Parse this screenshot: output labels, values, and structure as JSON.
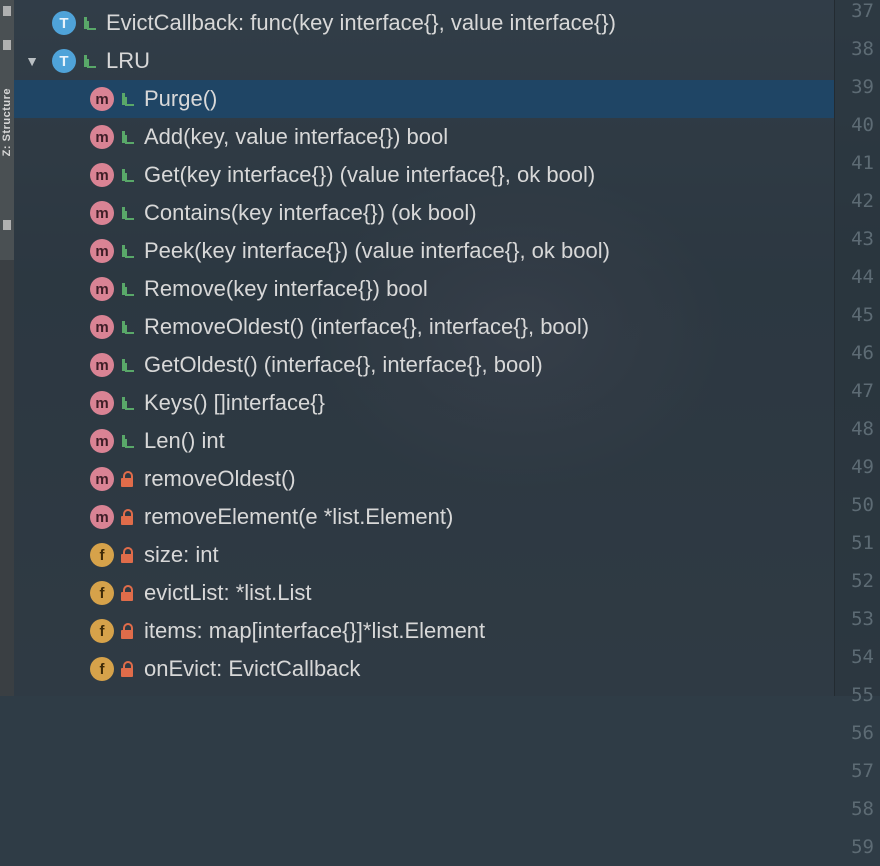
{
  "sidebar_tab": {
    "label": "Z: Structure"
  },
  "tree": [
    {
      "kind": "T",
      "vis": "pub",
      "label": "EvictCallback: func(key interface{}, value interface{})",
      "expanded": false,
      "depth": 0
    },
    {
      "kind": "T",
      "vis": "pub",
      "label": "LRU",
      "expanded": true,
      "depth": 0
    },
    {
      "kind": "m",
      "vis": "pub",
      "label": "Purge()",
      "depth": 1,
      "selected": true
    },
    {
      "kind": "m",
      "vis": "pub",
      "label": "Add(key, value interface{}) bool",
      "depth": 1
    },
    {
      "kind": "m",
      "vis": "pub",
      "label": "Get(key interface{}) (value interface{}, ok bool)",
      "depth": 1
    },
    {
      "kind": "m",
      "vis": "pub",
      "label": "Contains(key interface{}) (ok bool)",
      "depth": 1
    },
    {
      "kind": "m",
      "vis": "pub",
      "label": "Peek(key interface{}) (value interface{}, ok bool)",
      "depth": 1
    },
    {
      "kind": "m",
      "vis": "pub",
      "label": "Remove(key interface{}) bool",
      "depth": 1
    },
    {
      "kind": "m",
      "vis": "pub",
      "label": "RemoveOldest() (interface{}, interface{}, bool)",
      "depth": 1
    },
    {
      "kind": "m",
      "vis": "pub",
      "label": "GetOldest() (interface{}, interface{}, bool)",
      "depth": 1
    },
    {
      "kind": "m",
      "vis": "pub",
      "label": "Keys() []interface{}",
      "depth": 1
    },
    {
      "kind": "m",
      "vis": "pub",
      "label": "Len() int",
      "depth": 1
    },
    {
      "kind": "m",
      "vis": "priv",
      "label": "removeOldest()",
      "depth": 1
    },
    {
      "kind": "m",
      "vis": "priv",
      "label": "removeElement(e *list.Element)",
      "depth": 1
    },
    {
      "kind": "f",
      "vis": "priv",
      "label": "size: int",
      "depth": 1
    },
    {
      "kind": "f",
      "vis": "priv",
      "label": "evictList: *list.List",
      "depth": 1
    },
    {
      "kind": "f",
      "vis": "priv",
      "label": "items: map[interface{}]*list.Element",
      "depth": 1
    },
    {
      "kind": "f",
      "vis": "priv",
      "label": "onEvict: EvictCallback",
      "depth": 1
    }
  ],
  "line_numbers": [
    "37",
    "38",
    "39",
    "40",
    "41",
    "42",
    "43",
    "44",
    "45",
    "46",
    "47",
    "48",
    "49",
    "50",
    "51",
    "52",
    "53",
    "54",
    "55",
    "56",
    "57",
    "58",
    "59"
  ]
}
